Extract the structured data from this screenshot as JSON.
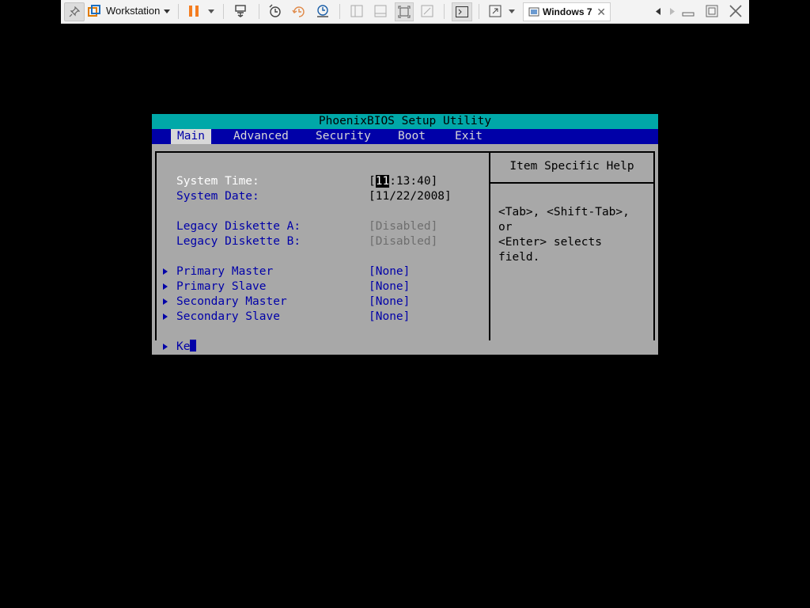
{
  "toolbar": {
    "product_label": "Workstation",
    "tab_label": "Windows 7",
    "tab_close": "✕"
  },
  "bios": {
    "title": "PhoenixBIOS Setup Utility",
    "menu": [
      {
        "label": "Main",
        "active": true
      },
      {
        "label": "Advanced",
        "active": false
      },
      {
        "label": "Security",
        "active": false
      },
      {
        "label": "Boot",
        "active": false
      },
      {
        "label": "Exit",
        "active": false
      }
    ],
    "fields": {
      "system_time": {
        "label": "System Time:",
        "open_bracket": "[",
        "hour": "11",
        "rest": ":13:40]"
      },
      "system_date": {
        "label": "System Date:",
        "value": "[11/22/2008]"
      },
      "diskette_a": {
        "label": "Legacy Diskette A:",
        "value": "[Disabled]"
      },
      "diskette_b": {
        "label": "Legacy Diskette B:",
        "value": "[Disabled]"
      },
      "primary_master": {
        "label": "Primary Master",
        "value": "[None]"
      },
      "primary_slave": {
        "label": "Primary Slave",
        "value": "[None]"
      },
      "secondary_master": {
        "label": "Secondary Master",
        "value": "[None]"
      },
      "secondary_slave": {
        "label": "Secondary Slave",
        "value": "[None]"
      },
      "partial": {
        "label": "Ke"
      }
    },
    "help": {
      "title": "Item Specific Help",
      "line1": "<Tab>, <Shift-Tab>, or",
      "line2": "<Enter> selects field."
    }
  },
  "colors": {
    "bios_title_bg": "#00a8a8",
    "bios_menu_bg": "#0000a8",
    "bios_body_bg": "#a8a8a8"
  }
}
